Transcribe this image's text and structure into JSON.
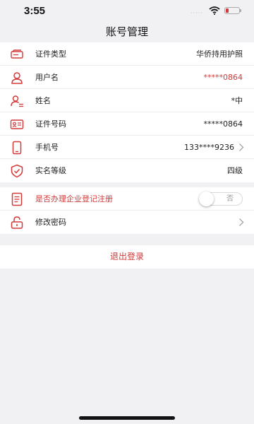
{
  "status": {
    "time": "3:55",
    "signal": "·····"
  },
  "nav": {
    "title": "账号管理"
  },
  "account_rows": [
    {
      "label": "证件类型",
      "value": "华侨持用护照",
      "icon": "id-card-icon"
    },
    {
      "label": "用户名",
      "value": "*****0864",
      "icon": "user-icon",
      "value_color": "#d23a3a"
    },
    {
      "label": "姓名",
      "value": "*中",
      "icon": "user-list-icon"
    },
    {
      "label": "证件号码",
      "value": "*****0864",
      "icon": "id-number-icon"
    },
    {
      "label": "手机号",
      "value": "133****9236",
      "icon": "phone-icon",
      "chevron": true
    },
    {
      "label": "实名等级",
      "value": "四级",
      "icon": "shield-check-icon"
    }
  ],
  "settings_rows": [
    {
      "label": "是否办理企业登记注册",
      "icon": "document-icon",
      "toggle_text": "否",
      "toggle_on": false
    },
    {
      "label": "修改密码",
      "icon": "lock-icon",
      "chevron": true
    }
  ],
  "logout": {
    "label": "退出登录"
  },
  "colors": {
    "accent": "#d23a3a",
    "background": "#f1f1f3"
  }
}
